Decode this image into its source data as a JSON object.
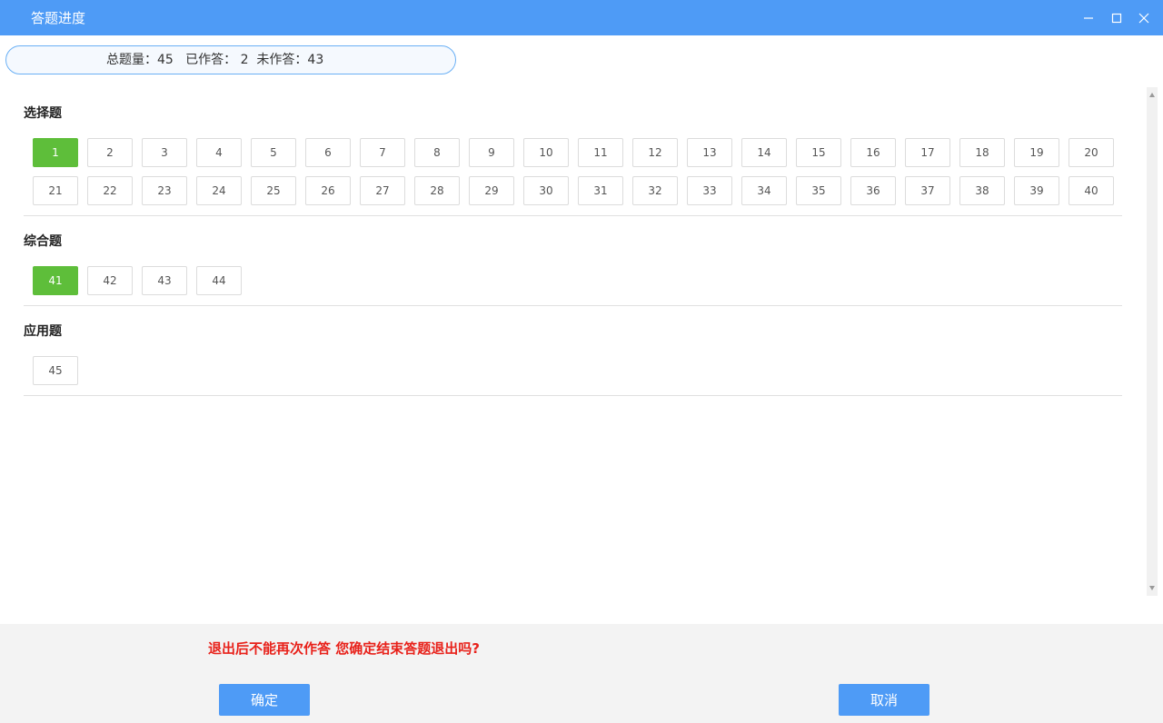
{
  "window": {
    "title": "答题进度",
    "controls": [
      "minimize-icon",
      "maximize-icon",
      "close-icon"
    ]
  },
  "summary": {
    "text": "总题量：45   已作答： 2  未作答：43"
  },
  "sections": [
    {
      "title": "选择题",
      "questions": [
        {
          "label": "1",
          "answered": true
        },
        {
          "label": "2",
          "answered": false
        },
        {
          "label": "3",
          "answered": false
        },
        {
          "label": "4",
          "answered": false
        },
        {
          "label": "5",
          "answered": false
        },
        {
          "label": "6",
          "answered": false
        },
        {
          "label": "7",
          "answered": false
        },
        {
          "label": "8",
          "answered": false
        },
        {
          "label": "9",
          "answered": false
        },
        {
          "label": "10",
          "answered": false
        },
        {
          "label": "11",
          "answered": false
        },
        {
          "label": "12",
          "answered": false
        },
        {
          "label": "13",
          "answered": false
        },
        {
          "label": "14",
          "answered": false
        },
        {
          "label": "15",
          "answered": false
        },
        {
          "label": "16",
          "answered": false
        },
        {
          "label": "17",
          "answered": false
        },
        {
          "label": "18",
          "answered": false
        },
        {
          "label": "19",
          "answered": false
        },
        {
          "label": "20",
          "answered": false
        },
        {
          "label": "21",
          "answered": false
        },
        {
          "label": "22",
          "answered": false
        },
        {
          "label": "23",
          "answered": false
        },
        {
          "label": "24",
          "answered": false
        },
        {
          "label": "25",
          "answered": false
        },
        {
          "label": "26",
          "answered": false
        },
        {
          "label": "27",
          "answered": false
        },
        {
          "label": "28",
          "answered": false
        },
        {
          "label": "29",
          "answered": false
        },
        {
          "label": "30",
          "answered": false
        },
        {
          "label": "31",
          "answered": false
        },
        {
          "label": "32",
          "answered": false
        },
        {
          "label": "33",
          "answered": false
        },
        {
          "label": "34",
          "answered": false
        },
        {
          "label": "35",
          "answered": false
        },
        {
          "label": "36",
          "answered": false
        },
        {
          "label": "37",
          "answered": false
        },
        {
          "label": "38",
          "answered": false
        },
        {
          "label": "39",
          "answered": false
        },
        {
          "label": "40",
          "answered": false
        }
      ]
    },
    {
      "title": "综合题",
      "questions": [
        {
          "label": "41",
          "answered": true
        },
        {
          "label": "42",
          "answered": false
        },
        {
          "label": "43",
          "answered": false
        },
        {
          "label": "44",
          "answered": false
        }
      ]
    },
    {
      "title": "应用题",
      "questions": [
        {
          "label": "45",
          "answered": false
        }
      ]
    }
  ],
  "footer": {
    "warning": "退出后不能再次作答 您确定结束答题退出吗?",
    "confirm_label": "确定",
    "cancel_label": "取消"
  },
  "colors": {
    "title_bar": "#4e9bf6",
    "answered": "#5ebe3a",
    "warning": "#e8211a",
    "button": "#4e9bf6"
  }
}
